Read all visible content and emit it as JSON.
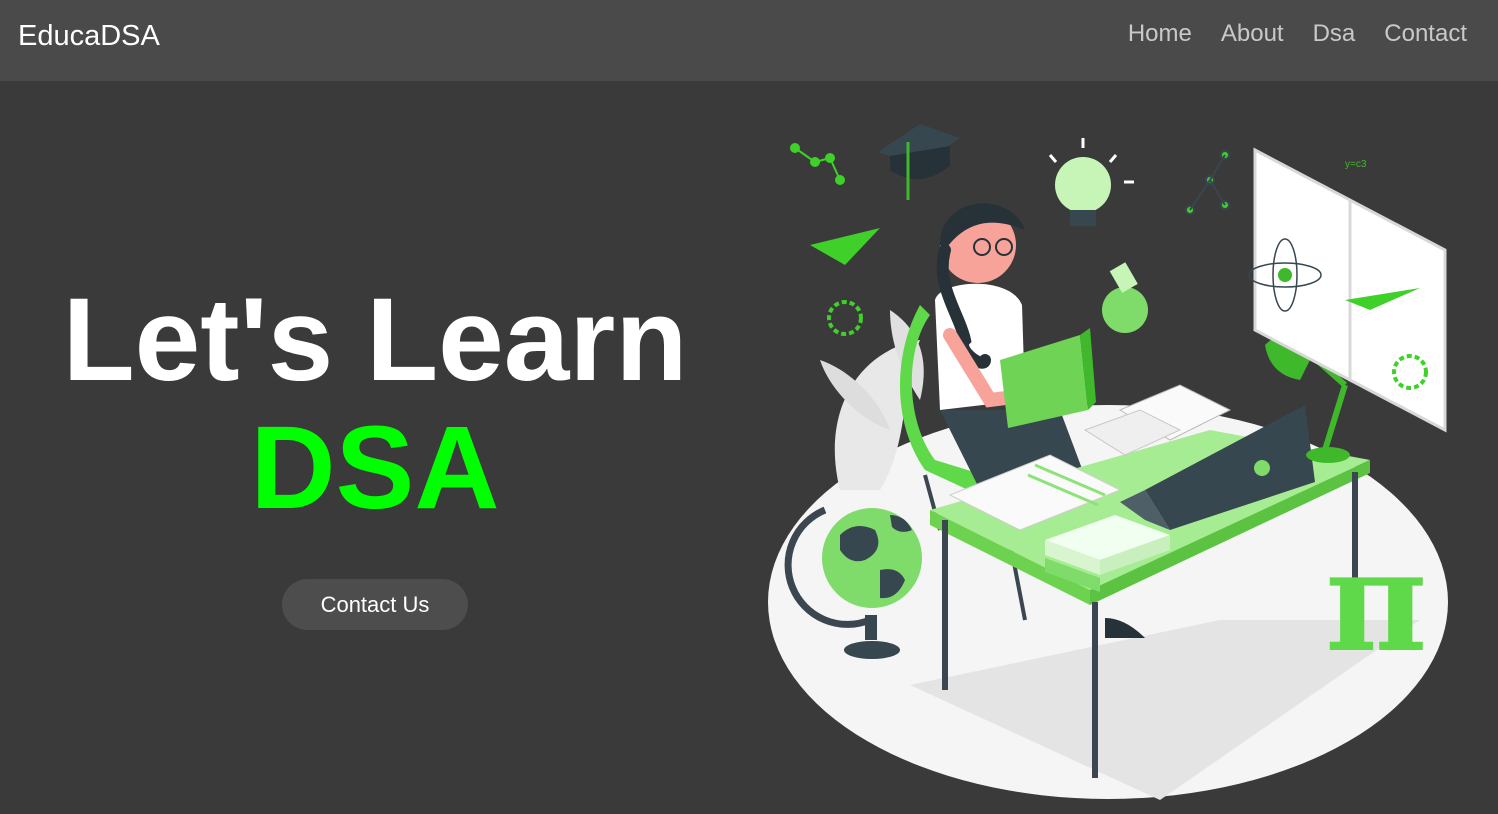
{
  "nav": {
    "brand": "EducaDSA",
    "links": [
      "Home",
      "About",
      "Dsa",
      "Contact"
    ]
  },
  "hero": {
    "line1": "Let's Learn",
    "line2": "DSA",
    "cta_label": "Contact Us"
  },
  "illustration": {
    "graph_label": "y=c3",
    "pi_symbol": "π"
  },
  "colors": {
    "accent_green": "#00ff00",
    "background": "#3a3a3a",
    "navbar": "#4a4a4a",
    "button": "#4d4d4d"
  }
}
